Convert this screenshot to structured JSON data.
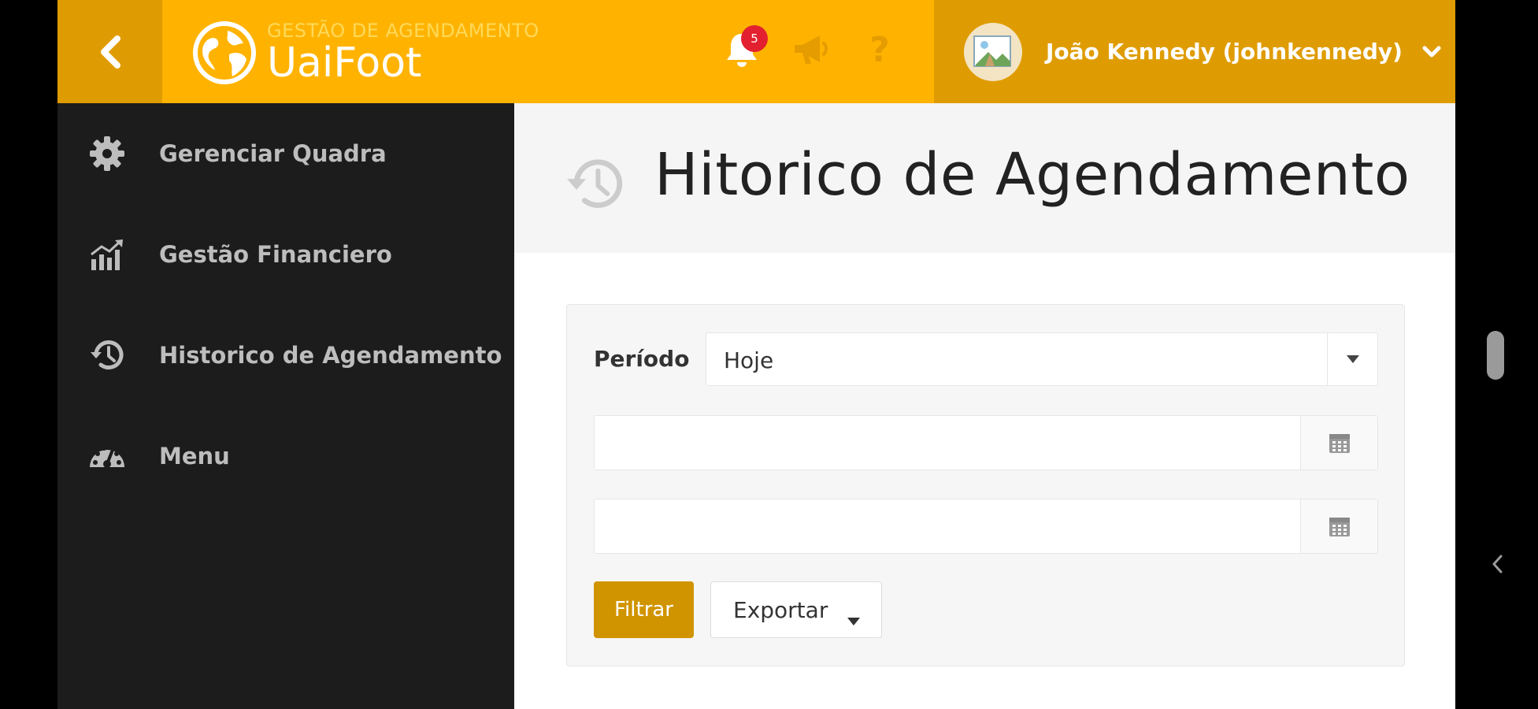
{
  "header": {
    "brand_subtitle": "GESTÃO DE AGENDAMENTO",
    "brand_title": "UaiFoot",
    "notification_count": "5",
    "help_glyph": "?",
    "user_name": "João Kennedy (johnkennedy)"
  },
  "sidebar": {
    "items": [
      {
        "label": "Gerenciar Quadra",
        "icon": "gear-icon"
      },
      {
        "label": "Gestão Financiero",
        "icon": "chart-icon"
      },
      {
        "label": "Historico de Agendamento",
        "icon": "history-icon"
      },
      {
        "label": "Menu",
        "icon": "dashboard-icon"
      }
    ]
  },
  "main": {
    "page_title": "Hitorico de Agendamento",
    "filter": {
      "period_label": "Período",
      "period_value": "Hoje",
      "start_date": "",
      "end_date": "",
      "filter_button": "Filtrar",
      "export_button": "Exportar"
    }
  },
  "colors": {
    "header": "#ffb300",
    "header_dark": "#df9c02",
    "sidebar": "#1c1c1c",
    "accent_button": "#d09400",
    "badge": "#e3202f"
  }
}
